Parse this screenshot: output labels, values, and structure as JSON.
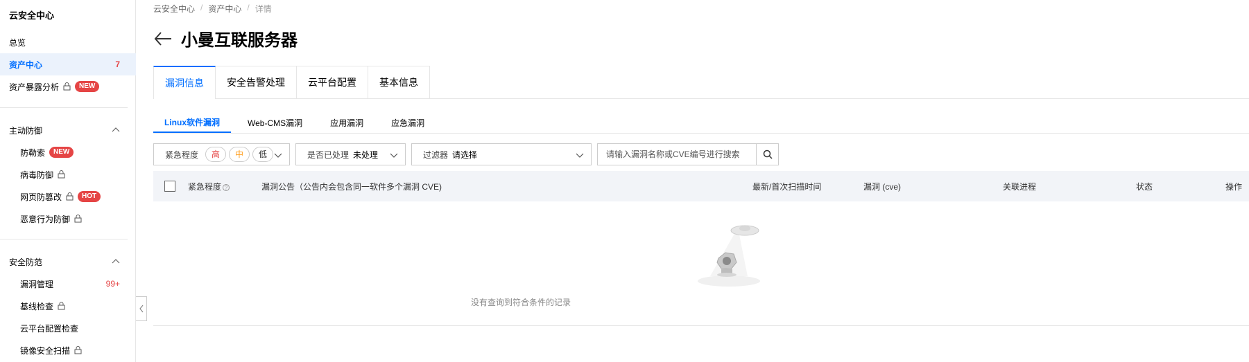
{
  "sidebar": {
    "title": "云安全中心",
    "items": [
      {
        "label": "总览"
      },
      {
        "label": "资产中心",
        "count": "7"
      },
      {
        "label": "资产暴露分析",
        "badge": "NEW"
      }
    ],
    "group1": {
      "title": "主动防御",
      "items": [
        {
          "label": "防勒索",
          "badge": "NEW"
        },
        {
          "label": "病毒防御"
        },
        {
          "label": "网页防篡改",
          "badge": "HOT"
        },
        {
          "label": "恶意行为防御"
        }
      ]
    },
    "group2": {
      "title": "安全防范",
      "items": [
        {
          "label": "漏洞管理",
          "count": "99+"
        },
        {
          "label": "基线检查"
        },
        {
          "label": "云平台配置检查"
        },
        {
          "label": "镜像安全扫描"
        }
      ]
    }
  },
  "breadcrumb": [
    "云安全中心",
    "/",
    "资产中心",
    "/",
    "详情"
  ],
  "page": {
    "title": "小曼互联服务器"
  },
  "tabs": [
    "漏洞信息",
    "安全告警处理",
    "云平台配置",
    "基本信息"
  ],
  "subtabs": [
    "Linux软件漏洞",
    "Web-CMS漏洞",
    "应用漏洞",
    "应急漏洞"
  ],
  "filters": {
    "urgency": {
      "label": "紧急程度",
      "options": [
        "高",
        "中",
        "低"
      ]
    },
    "handled": {
      "label": "是否已处理",
      "value": "未处理"
    },
    "filter": {
      "label": "过滤器",
      "value": "请选择"
    },
    "search_placeholder": "请输入漏洞名称或CVE编号进行搜索"
  },
  "table": {
    "columns": [
      "紧急程度",
      "漏洞公告（公告内会包含同一软件多个漏洞 CVE)",
      "最新/首次扫描时间",
      "漏洞 (cve)",
      "关联进程",
      "状态",
      "操作"
    ],
    "empty_text": "没有查询到符合条件的记录"
  },
  "colors": {
    "accent": "#006eff",
    "danger": "#e54545",
    "warning": "#ff9c19"
  }
}
